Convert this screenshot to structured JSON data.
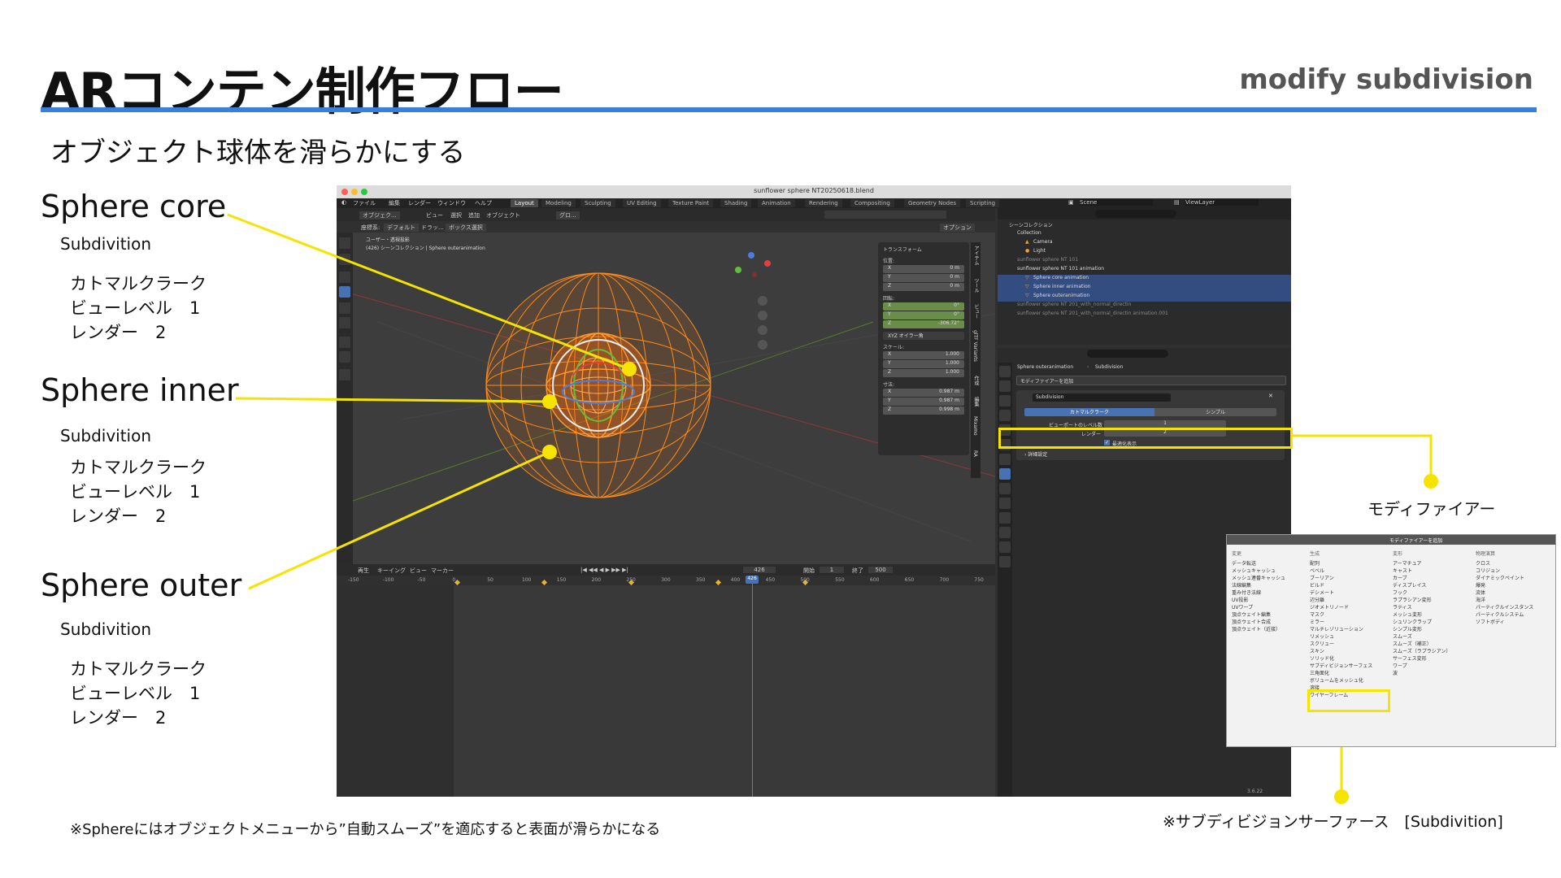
{
  "slide": {
    "title": "ARコンテン制作フロー",
    "right_title": "modify subdivision",
    "subtitle": "オブジェクト球体を滑らかにする",
    "footnote": "※Sphereにはオブジェクトメニューから”自動スムーズ”を適応すると表面が滑らかになる",
    "modifier_label": "モディファイアー",
    "subdivision_note": "※サブディビジョンサーファース　[Subdivition]"
  },
  "labels": [
    {
      "name": "Sphere core",
      "sub": "Subdivition",
      "items": [
        "カトマルクラーク",
        "ビューレベル　1",
        "レンダー　2"
      ]
    },
    {
      "name": "Sphere inner",
      "sub": "Subdivition",
      "items": [
        "カトマルクラーク",
        "ビューレベル　1",
        "レンダー　2"
      ]
    },
    {
      "name": "Sphere outer",
      "sub": "Subdivition",
      "items": [
        "カトマルクラーク",
        "ビューレベル　1",
        "レンダー　2"
      ]
    }
  ],
  "blender": {
    "window_title": "sunflower sphere NT20250618.blend",
    "menu": [
      "ファイル",
      "編集",
      "レンダー",
      "ウィンドウ",
      "ヘルプ"
    ],
    "workspaces": [
      "Layout",
      "Modeling",
      "Sculpting",
      "UV Editing",
      "Texture Paint",
      "Shading",
      "Animation",
      "Rendering",
      "Compositing",
      "Geometry Nodes",
      "Scripting"
    ],
    "active_workspace": "Layout",
    "scene": "Scene",
    "view_layer": "ViewLayer",
    "vp_header": {
      "mode": "オブジェク...",
      "view": "ビュー",
      "select": "選択",
      "add": "追加",
      "object": "オブジェクト",
      "global": "グロ..."
    },
    "vp_header2": {
      "coord": "座標系:",
      "default": "デフォルト",
      "drag": "ドラッ...",
      "box": "ボックス選択",
      "options": "オプション"
    },
    "overlay_text": [
      "ユーザー・透視投影",
      "(426) シーンコレクション | Sphere outeranimation"
    ],
    "transform": {
      "title": "トランスフォーム",
      "location_label": "位置:",
      "location": [
        {
          "axis": "X",
          "value": "0 m"
        },
        {
          "axis": "Y",
          "value": "0 m"
        },
        {
          "axis": "Z",
          "value": "0 m"
        }
      ],
      "rotation_label": "回転:",
      "rotation": [
        {
          "axis": "X",
          "value": "0°"
        },
        {
          "axis": "Y",
          "value": "0°"
        },
        {
          "axis": "Z",
          "value": "-306.72°"
        }
      ],
      "rotation_mode": "XYZ オイラー角",
      "scale_label": "スケール:",
      "scale": [
        {
          "axis": "X",
          "value": "1.000"
        },
        {
          "axis": "Y",
          "value": "1.000"
        },
        {
          "axis": "Z",
          "value": "1.000"
        }
      ],
      "dimensions_label": "寸法:",
      "dimensions": [
        {
          "axis": "X",
          "value": "0.987 m"
        },
        {
          "axis": "Y",
          "value": "0.987 m"
        },
        {
          "axis": "Z",
          "value": "0.998 m"
        }
      ]
    },
    "side_tabs": [
      "アイテム",
      "ツール",
      "ビュー",
      "glTF Variants",
      "作成",
      "編集",
      "Mixamo",
      "RA"
    ],
    "outliner": [
      {
        "label": "シーンコレクション",
        "state": ""
      },
      {
        "label": "Collection",
        "state": ""
      },
      {
        "label": "Camera",
        "state": ""
      },
      {
        "label": "Light",
        "state": ""
      },
      {
        "label": "sunflower sphere NT 101",
        "state": "dim"
      },
      {
        "label": "sunflower sphere NT 101 animation",
        "state": ""
      },
      {
        "label": "Sphere core animation",
        "state": "sel"
      },
      {
        "label": "Sphere inner animation",
        "state": "sel"
      },
      {
        "label": "Sphere outeranimation",
        "state": "sel"
      },
      {
        "label": "sunflower sphere NT 201_with_normal_directin",
        "state": "dim"
      },
      {
        "label": "sunflower sphere NT 201_with_normal_directin animation.001",
        "state": "dim"
      }
    ],
    "props": {
      "breadcrumb_obj": "Sphere outeranimation",
      "breadcrumb_mod": "Subdivision",
      "add_modifier": "モディファイアーを追加",
      "modifier_name": "Subdivision",
      "seg_a": "カトマルクラーク",
      "seg_b": "シンプル",
      "viewport_levels_label": "ビューポートのレベル数",
      "viewport_levels": "1",
      "render_label": "レンダー",
      "render_levels": "2",
      "optimal_label": "最適化表示",
      "advanced_label": "詳細設定"
    },
    "timeline": {
      "playback": "再生",
      "keying": "キーイング",
      "view": "ビュー",
      "marker": "マーカー",
      "current_frame": "426",
      "start_label": "開始",
      "start": "1",
      "end_label": "終了",
      "end": "500",
      "ticks": [
        "-150",
        "-100",
        "-50",
        "0",
        "50",
        "100",
        "150",
        "200",
        "250",
        "300",
        "350",
        "400",
        "450",
        "500",
        "550",
        "600",
        "650",
        "700",
        "750"
      ],
      "playhead_label": "426",
      "keyframes": [
        0,
        125,
        250,
        375,
        500
      ]
    },
    "version": "3.6.22"
  },
  "popup": {
    "title": "モディファイアーを追加",
    "columns": [
      {
        "header": "変更",
        "items": [
          "データ転送",
          "メッシュキャッシュ",
          "メッシュ連番キャッシュ",
          "法線編集",
          "重み付き法線",
          "UV投影",
          "UVワープ",
          "頂点ウェイト編集",
          "頂点ウェイト合成",
          "頂点ウェイト（近接）"
        ]
      },
      {
        "header": "生成",
        "items": [
          "配列",
          "ベベル",
          "ブーリアン",
          "ビルド",
          "デシメート",
          "辺分離",
          "ジオメトリノード",
          "マスク",
          "ミラー",
          "マルチレゾリューション",
          "リメッシュ",
          "スクリュー",
          "スキン",
          "ソリッド化",
          "サブディビジョンサーフェス",
          "三角面化",
          "ボリュームをメッシュ化",
          "溶接",
          "ワイヤーフレーム"
        ]
      },
      {
        "header": "変形",
        "items": [
          "アーマチュア",
          "キャスト",
          "カーブ",
          "ディスプレイス",
          "フック",
          "ラプラシアン変形",
          "ラティス",
          "メッシュ変形",
          "シュリンクラップ",
          "シンプル変形",
          "スムーズ",
          "スムーズ（補正）",
          "スムーズ（ラプラシアン）",
          "サーフェス変形",
          "ワープ",
          "波"
        ]
      },
      {
        "header": "物理演算",
        "items": [
          "クロス",
          "コリジョン",
          "ダイナミックペイント",
          "爆発",
          "流体",
          "海洋",
          "パーティクルインスタンス",
          "パーティクルシステム",
          "ソフトボディ"
        ]
      }
    ]
  }
}
